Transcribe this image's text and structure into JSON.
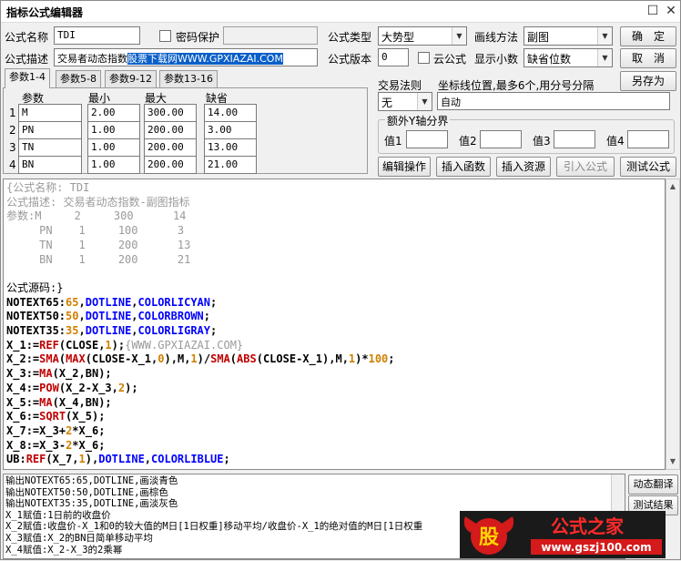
{
  "window": {
    "title": "指标公式编辑器",
    "maximize_glyph": "☐",
    "close_glyph": "✕"
  },
  "form": {
    "name_label": "公式名称",
    "name_value": "TDI",
    "password_label": "密码保护",
    "desc_label": "公式描述",
    "desc_plain": "交易者动态指数",
    "desc_selected": "股票下载网WWW.GPXIAZAI.COM",
    "type_label": "公式类型",
    "type_value": "大势型",
    "draw_label": "画线方法",
    "draw_value": "副图",
    "version_label": "公式版本",
    "version_value": "0",
    "cloud_label": "云公式",
    "decimal_label": "显示小数",
    "decimal_value": "缺省位数",
    "trade_label": "交易法则",
    "trade_value": "无",
    "coord_label": "坐标线位置,最多6个,用分号分隔",
    "coord_value": "自动",
    "yaxis_label": "额外Y轴分界",
    "y_values": [
      {
        "label": "值1"
      },
      {
        "label": "值2"
      },
      {
        "label": "值3"
      },
      {
        "label": "值4"
      }
    ]
  },
  "buttons": {
    "ok": "确　定",
    "cancel": "取　消",
    "save_as": "另存为",
    "edit": "编辑操作",
    "insert_func": "插入函数",
    "insert_res": "插入资源",
    "import": "引入公式",
    "test": "测试公式",
    "translate": "动态翻译",
    "test_result": "测试结果"
  },
  "tabs": [
    "参数1-4",
    "参数5-8",
    "参数9-12",
    "参数13-16"
  ],
  "params": {
    "headers": [
      "参数",
      "最小",
      "最大",
      "缺省"
    ],
    "rows": [
      {
        "idx": "1",
        "name": "M",
        "min": "2.00",
        "max": "300.00",
        "def": "14.00"
      },
      {
        "idx": "2",
        "name": "PN",
        "min": "1.00",
        "max": "200.00",
        "def": "3.00"
      },
      {
        "idx": "3",
        "name": "TN",
        "min": "1.00",
        "max": "200.00",
        "def": "13.00"
      },
      {
        "idx": "4",
        "name": "BN",
        "min": "1.00",
        "max": "200.00",
        "def": "21.00"
      }
    ]
  },
  "code_lines": [
    {
      "t": "{公式名称: TDI",
      "c": "#9a9a9a",
      "b": false
    },
    {
      "t": "公式描述: 交易者动态指数-副图指标",
      "c": "#9a9a9a",
      "b": false
    },
    {
      "t": "参数:M     2     300      14",
      "c": "#9a9a9a",
      "b": false
    },
    {
      "t": "     PN    1     100      3",
      "c": "#9a9a9a",
      "b": false
    },
    {
      "t": "     TN    1     200      13",
      "c": "#9a9a9a",
      "b": false
    },
    {
      "t": "     BN    1     200      21",
      "c": "#9a9a9a",
      "b": false
    },
    {
      "t": " ",
      "c": "#000",
      "b": false
    },
    {
      "t": "公式源码:}",
      "c": "#000",
      "b": false
    },
    {
      "t": "NOTEXT65:65,DOTLINE,COLORLICYAN;",
      "c": "#000",
      "b": true
    },
    {
      "t": "NOTEXT50:50,DOTLINE,COLORBROWN;",
      "c": "#000",
      "b": true
    },
    {
      "t": "NOTEXT35:35,DOTLINE,COLORLIGRAY;",
      "c": "#000",
      "b": true
    },
    {
      "t": "X_1:=REF(CLOSE,1);{WWW.GPXIAZAI.COM}",
      "c": "#000",
      "b": true
    },
    {
      "t": "X_2:=SMA(MAX(CLOSE-X_1,0),M,1)/SMA(ABS(CLOSE-X_1),M,1)*100;",
      "c": "#000",
      "b": true
    },
    {
      "t": "X_3:=MA(X_2,BN);",
      "c": "#000",
      "b": true
    },
    {
      "t": "X_4:=POW(X_2-X_3,2);",
      "c": "#000",
      "b": true
    },
    {
      "t": "X_5:=MA(X_4,BN);",
      "c": "#000",
      "b": true
    },
    {
      "t": "X_6:=SQRT(X_5);",
      "c": "#000",
      "b": true
    },
    {
      "t": "X_7:=X_3+2*X_6;",
      "c": "#000",
      "b": true
    },
    {
      "t": "X_8:=X_3-2*X_6;",
      "c": "#000",
      "b": true
    },
    {
      "t": "UB:REF(X_7,1),DOTLINE,COLORLIBLUE;",
      "c": "#000",
      "b": true
    }
  ],
  "output_lines": [
    "输出NOTEXT65:65,DOTLINE,画淡青色",
    "输出NOTEXT50:50,DOTLINE,画棕色",
    "输出NOTEXT35:35,DOTLINE,画淡灰色",
    "X_1赋值:1日前的收盘价",
    "X_2赋值:收盘价-X_1和0的较大值的M日[1日权重]移动平均/收盘价-X_1的绝对值的M日[1日权重",
    "X_3赋值:X_2的BN日简单移动平均",
    "X_4赋值:X_2-X_3的2乘幂"
  ],
  "logo": {
    "char": "股",
    "text": "公式之家",
    "url": "www.gszj100.com"
  },
  "colors": {
    "keyword": "#0000ff",
    "func": "#c00000",
    "number": "#d08000",
    "comment": "#9a9a9a",
    "selection": "#0a5fc8"
  }
}
